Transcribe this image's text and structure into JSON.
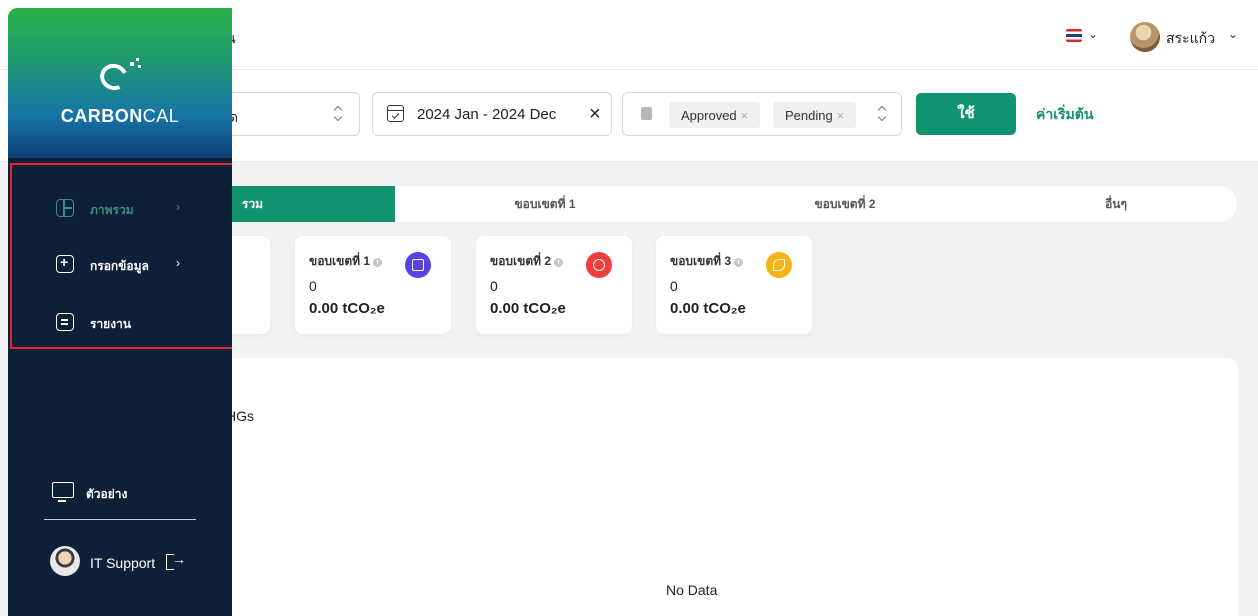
{
  "header": {
    "title_fragment": "น",
    "user_name": "สระแก้ว",
    "language_flag": "thai-flag-icon"
  },
  "filters": {
    "org_select_value": "ด",
    "date_range": "2024 Jan - 2024 Dec",
    "status_tags": [
      "Approved",
      "Pending"
    ],
    "apply_label": "ใช้",
    "reset_label": "ค่าเริ่มต้น"
  },
  "tabs": [
    "รวม",
    "ขอบเขตที่ 1",
    "ขอบเขตที่ 2",
    "อื่นๆ"
  ],
  "cards": [
    {
      "title": "ขอบเขตที่ 1",
      "count": "0",
      "value": "0.00 tCO₂e",
      "icon": "factory-icon",
      "color": "#5743e0"
    },
    {
      "title": "ขอบเขตที่ 2",
      "count": "0",
      "value": "0.00 tCO₂e",
      "icon": "electricity-icon",
      "color": "#ef3e3e"
    },
    {
      "title": "ขอบเขตที่ 3",
      "count": "0",
      "value": "0.00 tCO₂e",
      "icon": "plane-icon",
      "color": "#f5b416"
    }
  ],
  "panel": {
    "ghg_label_fragment": "HGs",
    "no_data": "No Data"
  },
  "sidebar": {
    "brand_bold": "CARBON",
    "brand_light": "CAL",
    "nav": [
      {
        "label": "ภาพรวม",
        "icon": "dashboard-icon"
      },
      {
        "label": "กรอกข้อมูล",
        "icon": "add-data-icon"
      },
      {
        "label": "รายงาน",
        "icon": "report-icon"
      }
    ],
    "example_label": "ตัวอย่าง",
    "support_name": "IT Support"
  },
  "colors": {
    "accent": "#12936f",
    "sidebar_bg": "#0e1f38",
    "highlight_box": "#e0282e"
  }
}
